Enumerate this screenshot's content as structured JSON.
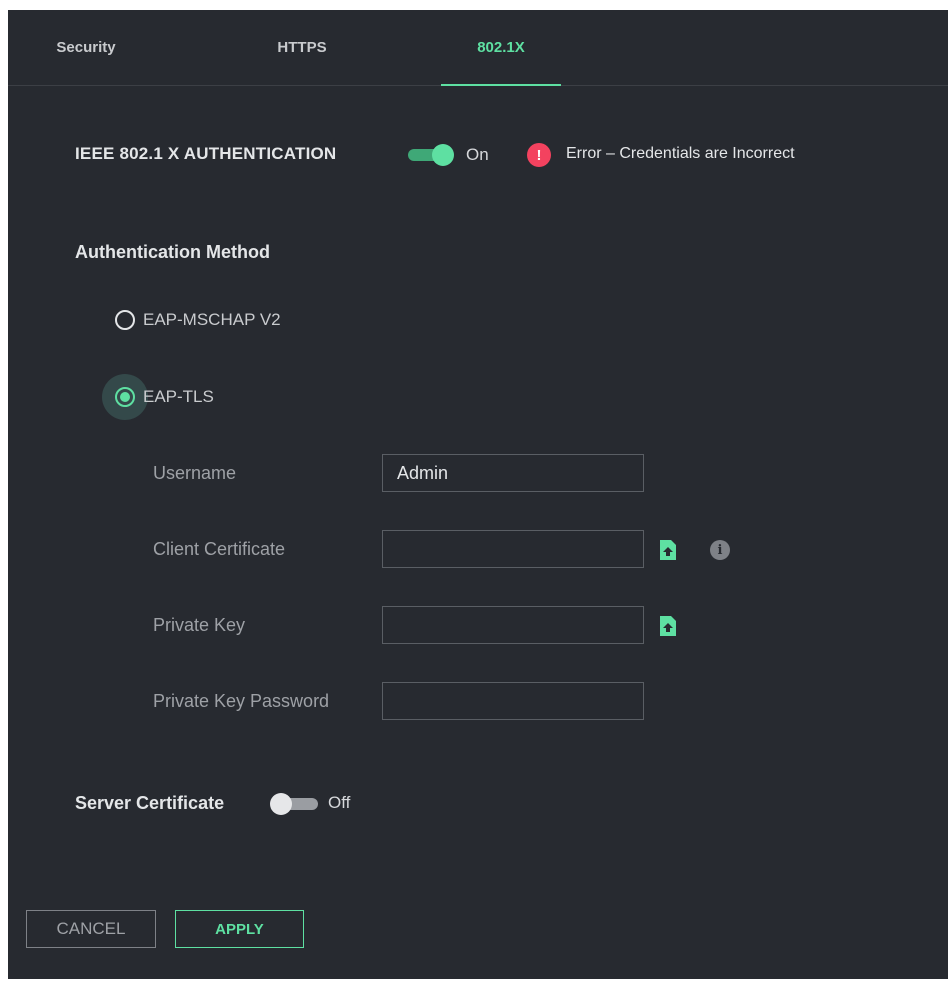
{
  "tabs": [
    {
      "label": "Security",
      "active": false
    },
    {
      "label": "HTTPS",
      "active": false
    },
    {
      "label": "802.1X",
      "active": true
    }
  ],
  "auth": {
    "title": "IEEE 802.1 X AUTHENTICATION",
    "toggle_state": "On",
    "error_icon": "!",
    "error_text": "Error – Credentials are Incorrect"
  },
  "method": {
    "title": "Authentication Method",
    "options": [
      {
        "label": "EAP-MSCHAP V2",
        "selected": false
      },
      {
        "label": "EAP-TLS",
        "selected": true
      }
    ]
  },
  "fields": {
    "username_label": "Username",
    "username_value": "Admin",
    "client_cert_label": "Client Certificate",
    "client_cert_value": "",
    "private_key_label": "Private Key",
    "private_key_value": "",
    "private_key_password_label": "Private Key Password",
    "private_key_password_value": ""
  },
  "server": {
    "title": "Server Certificate",
    "toggle_state": "Off"
  },
  "buttons": {
    "cancel": "CANCEL",
    "apply": "APPLY"
  },
  "icons": {
    "upload": "file-upload-icon",
    "info": "info-icon",
    "error": "error-icon"
  },
  "colors": {
    "accent": "#5ee0a2",
    "error": "#f3425f",
    "background": "#272a30"
  }
}
